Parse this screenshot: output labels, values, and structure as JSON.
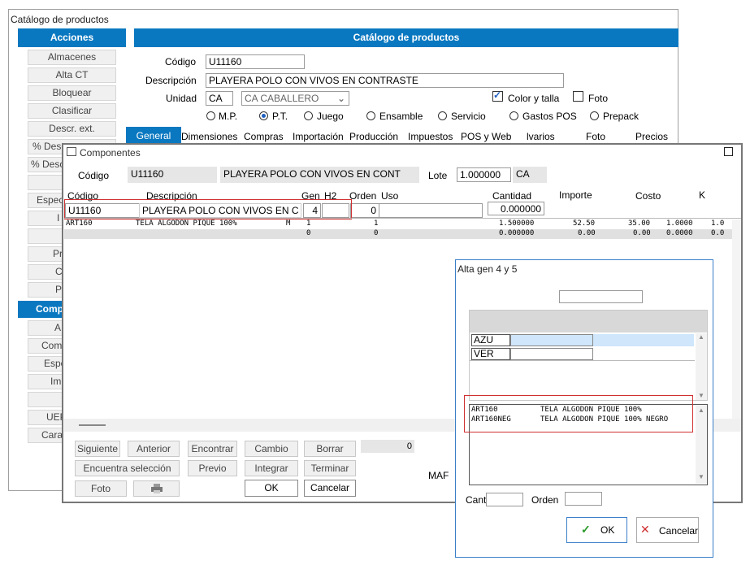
{
  "main_window": {
    "title": "Catálogo de productos",
    "actions_header": "Acciones",
    "catalog_header": "Catálogo de productos",
    "sidebar_buttons": [
      "Almacenes",
      "Alta CT",
      "Bloquear",
      "Clasificar",
      "Descr. ext.",
      "% Desc",
      "% Desc",
      "",
      "Espec",
      "I",
      "",
      "Pr",
      "C",
      "P"
    ],
    "comp_header": "Comp",
    "sidebar_buttons2": [
      "A",
      "Com",
      "Espe",
      "Im",
      "",
      "UEP",
      "Cara"
    ],
    "codigo_label": "Código",
    "codigo_value": "U11160",
    "descripcion_label": "Descripción",
    "descripcion_value": "PLAYERA POLO CON VIVOS EN CONTRASTE",
    "unidad_label": "Unidad",
    "unidad_value": "CA",
    "unidad_select": "CA  CABALLERO",
    "color_talla": "Color y talla",
    "foto": "Foto",
    "radios": [
      "M.P.",
      "P.T.",
      "Juego",
      "Ensamble",
      "Servicio",
      "Gastos POS",
      "Prepack"
    ],
    "tabs": [
      "General",
      "Dimensiones",
      "Compras",
      "Importación",
      "Producción",
      "Impuestos",
      "POS y Web",
      "lvarios",
      "Foto",
      "Precios"
    ],
    "maf": "MAF"
  },
  "componentes": {
    "title": "Componentes",
    "codigo_label": "Código",
    "codigo_value": "U11160",
    "descripcion_value": "PLAYERA POLO CON VIVOS EN CONT",
    "lote_label": "Lote",
    "lote_value": "1.000000",
    "lote_unit": "CA",
    "col_headers": {
      "codigo": "Código",
      "descripcion": "Descripción",
      "gen": "Gen",
      "h2": "H2",
      "orden": "Orden",
      "uso": "Uso",
      "cantidad": "Cantidad",
      "importe": "Importe",
      "costo": "Costo",
      "k": "K"
    },
    "edit_row": {
      "codigo": "U11160",
      "descripcion": "PLAYERA POLO CON VIVOS EN C CA",
      "gen": "4",
      "orden": "0",
      "cantidad": "0.000000"
    },
    "rows": [
      {
        "codigo": "ART160",
        "descripcion": "TELA ALGODON PIQUE 100%",
        "m": "M",
        "gen": "1",
        "orden": "1",
        "cantidad": "1.500000",
        "importe": "52.50",
        "costo": "35.00",
        "k": "1.0000",
        "extra": "1.0"
      },
      {
        "codigo": "",
        "descripcion": "",
        "m": "",
        "gen": "0",
        "orden": "0",
        "cantidad": "0.000000",
        "importe": "0.00",
        "costo": "0.00",
        "k": "0.0000",
        "extra": "0.0"
      }
    ],
    "buttons_row1": [
      "Siguiente",
      "Anterior",
      "Encontrar",
      "Cambio",
      "Borrar"
    ],
    "buttons_row2": [
      "Encuentra selección",
      "Previo",
      "Integrar",
      "Terminar"
    ],
    "buttons_row3": [
      "Foto",
      "",
      "OK",
      "Cancelar"
    ],
    "count_value": "0"
  },
  "alta_gen": {
    "title": "Alta gen 4 y 5",
    "list_items": [
      "AZU",
      "VER"
    ],
    "results": [
      {
        "codigo": "ART160",
        "descripcion": "TELA ALGODON PIQUE 100%"
      },
      {
        "codigo": "ART160NEG",
        "descripcion": "TELA ALGODON PIQUE 100% NEGRO"
      }
    ],
    "cant_label": "Cant",
    "orden_label": "Orden",
    "ok_label": "OK",
    "cancel_label": "Cancelar"
  },
  "colors": {
    "accent": "#0a78c0",
    "highlight": "#cfe6fb",
    "red_outline": "#d03030"
  }
}
